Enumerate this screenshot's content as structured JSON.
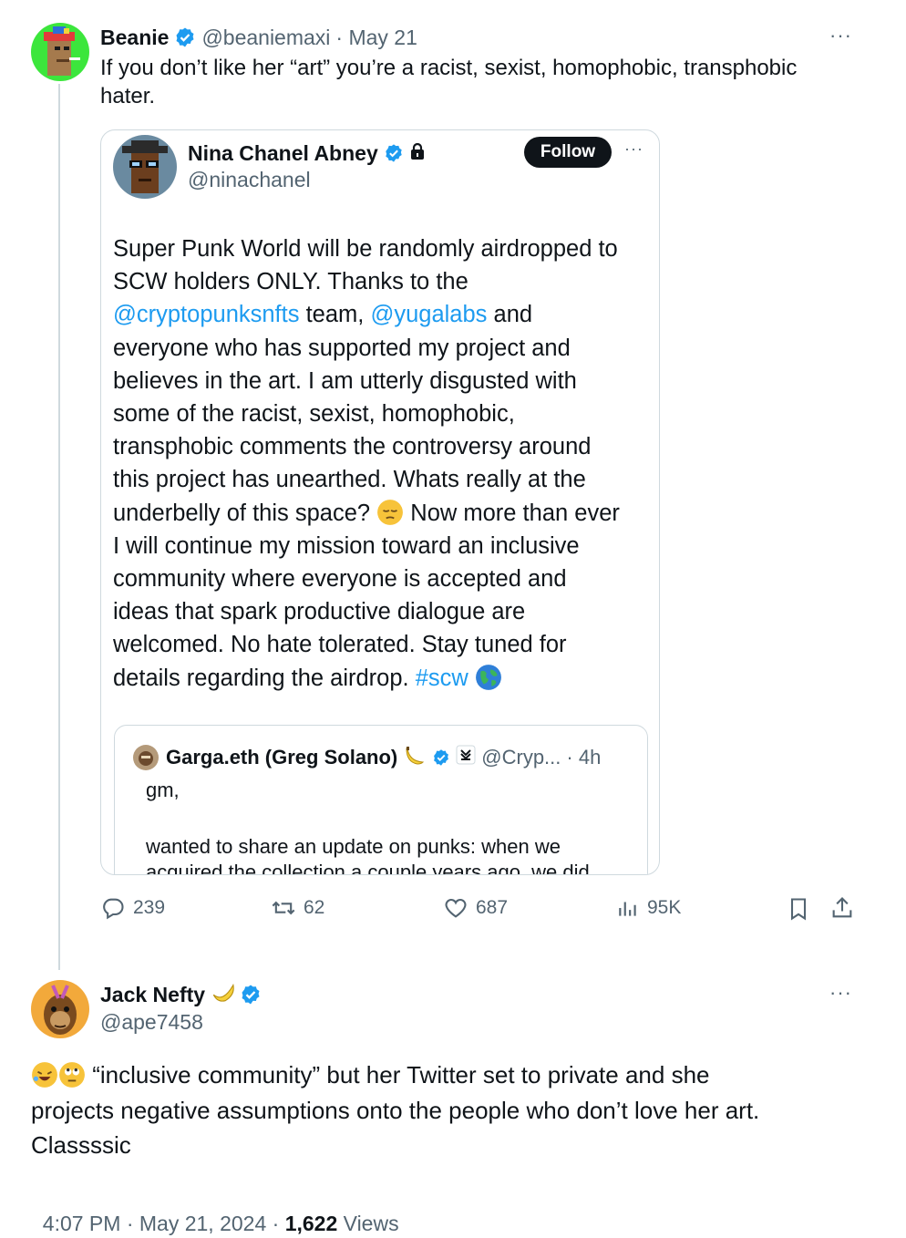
{
  "tweet1": {
    "author": "Beanie",
    "handle": "@beaniemaxi",
    "date": "· May 21",
    "more": "···",
    "text": "If you don’t like her “art” you’re a racist, sexist, homophobic, transphobic hater."
  },
  "quote": {
    "author": "Nina Chanel Abney",
    "handle": "@ninachanel",
    "follow_label": "Follow",
    "more": "···",
    "text_lines": [
      "Super Punk World will be randomly airdropped to",
      "SCW holders ONLY.  Thanks to the",
      "team,",
      "and",
      "everyone who has supported my project and",
      "believes in the art.  I am utterly disgusted with",
      "some of the racist, sexist, homophobic,",
      "transphobic comments the controversy around",
      "this project has unearthed.  Whats really at the",
      "underbelly of this space?",
      "Now more than ever",
      "I will continue my mission toward an inclusive",
      "community where everyone is accepted and",
      "ideas that spark productive dialogue are",
      "welcomed.  No hate tolerated.  Stay tuned for",
      "details regarding the airdrop."
    ],
    "mention1": "@cryptopunksnfts",
    "mention2": "@yugalabs",
    "hashtag": "#scw",
    "emoji_pensive": "pensive-face-emoji",
    "emoji_globe": "globe-emoji"
  },
  "nested_quote": {
    "author": "Garga.eth (Greg Solano)",
    "handle": "@Cryp...",
    "time": "· 4h",
    "text1": "gm,",
    "text2": "wanted to share an update on punks: when we",
    "text3": "acquired the collection a couple years ago, we did"
  },
  "actions": {
    "replies": "239",
    "reposts": "62",
    "likes": "687",
    "views": "95K"
  },
  "tweet2": {
    "author": "Jack Nefty",
    "handle": "@ape7458",
    "more": "···",
    "line1": "“inclusive community” but her Twitter set to private and she",
    "line2": "projects negative assumptions onto the people who don’t love her art.",
    "line3": "Classssic",
    "timestamp": "4:07 PM · May 21, 2024 · ",
    "views_count": "1,622",
    "views_label": " Views"
  },
  "colors": {
    "accent": "#1d9bf0",
    "text": "#0f1419",
    "secondary": "#536471",
    "border": "#cfd9de"
  }
}
